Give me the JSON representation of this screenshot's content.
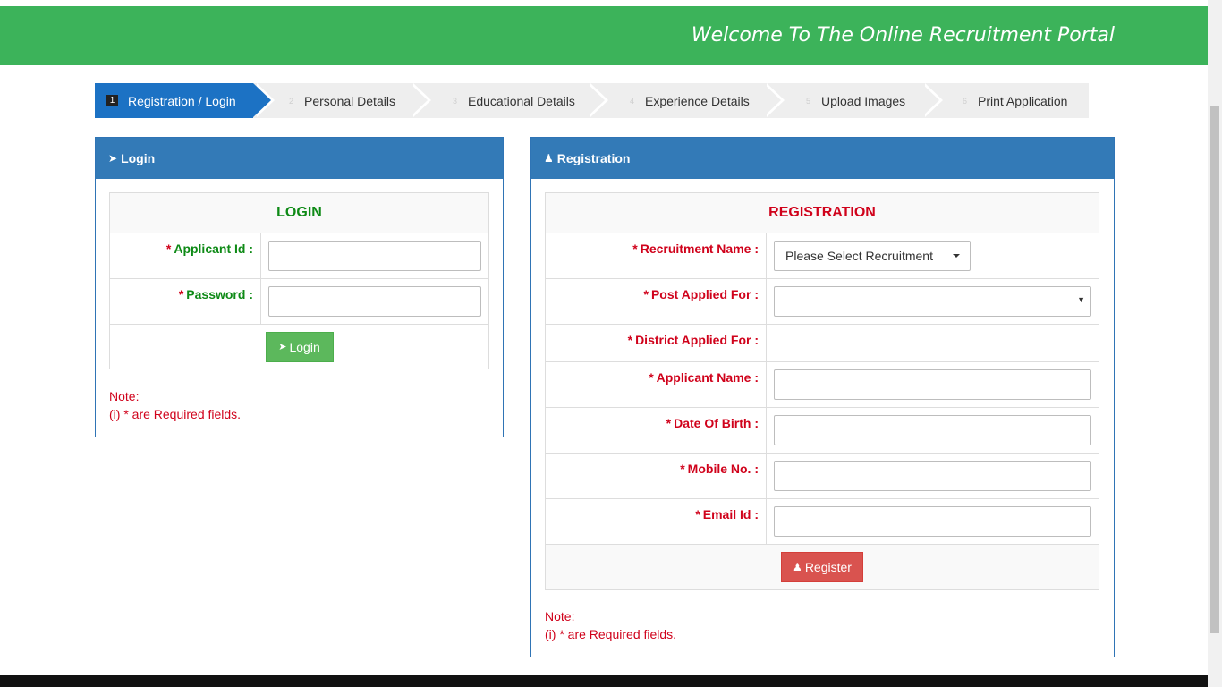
{
  "header": {
    "welcome": "Welcome To The Online Recruitment Portal"
  },
  "steps": [
    {
      "num": "1",
      "label": "Registration / Login",
      "active": true
    },
    {
      "num": "2",
      "label": "Personal Details"
    },
    {
      "num": "3",
      "label": "Educational Details"
    },
    {
      "num": "4",
      "label": "Experience Details"
    },
    {
      "num": "5",
      "label": "Upload Images"
    },
    {
      "num": "6",
      "label": "Print Application"
    }
  ],
  "login": {
    "panel_title": "Login",
    "section_title": "LOGIN",
    "applicant_id_label": "Applicant Id :",
    "password_label": "Password :",
    "star": "*",
    "button": "Login",
    "note_title": "Note:",
    "note_text": "(i) * are Required fields."
  },
  "registration": {
    "panel_title": "Registration",
    "section_title": "REGISTRATION",
    "star": "*",
    "recruitment_label": "Recruitment Name :",
    "recruitment_select": "Please Select Recruitment",
    "post_label": "Post Applied For :",
    "district_label": "District Applied For :",
    "applicant_name_label": "Applicant Name :",
    "dob_label": "Date Of Birth :",
    "mobile_label": "Mobile No. :",
    "email_label": "Email Id :",
    "button": "Register",
    "note_title": "Note:",
    "note_text": "(i) * are Required fields."
  },
  "colors": {
    "header": "#3cb35a",
    "panel": "#337ab7",
    "green_label": "#0e8a16",
    "red_label": "#d0021b"
  },
  "icons": {
    "login": "sign-in-icon",
    "registration": "user-icon"
  }
}
